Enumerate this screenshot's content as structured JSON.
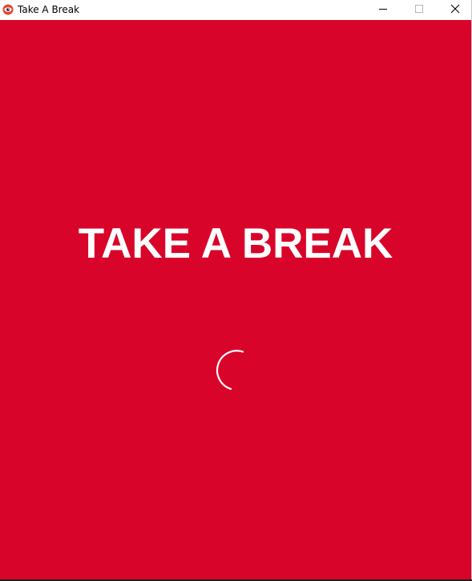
{
  "window": {
    "title": "Take A Break",
    "icon": "eye-icon",
    "controls": {
      "minimize": "minimize-icon",
      "maximize": "maximize-icon",
      "close": "close-icon"
    }
  },
  "main": {
    "headline": "TAKE A BREAK",
    "background_color": "#d9042a",
    "text_color": "#ffffff",
    "indicator": "loading-spinner-icon"
  }
}
